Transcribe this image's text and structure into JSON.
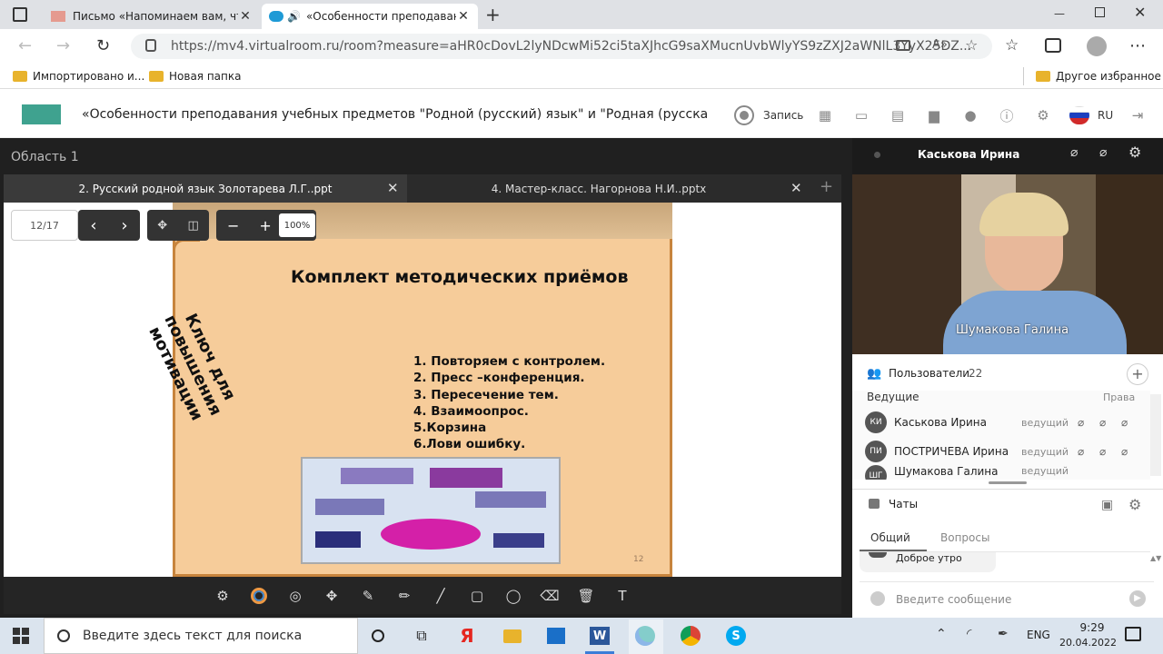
{
  "browser": {
    "tabs": [
      {
        "title": "Письмо «Напоминаем вам, что"
      },
      {
        "title": "«Особенности преподаван"
      }
    ],
    "new_tab": "+",
    "url": "https://mv4.virtualroom.ru/room?measure=aHR0cDovL2lyNDcwMi52ci5taXJhcG9saXMucnUvbWlyYS9zZXJ2aWNlL3YyX25DZ...",
    "bookmarks": [
      "Импортировано и...",
      "Новая папка"
    ],
    "other_bookmarks": "Другое избранное"
  },
  "app": {
    "title": "«Особенности преподавания учебных предметов \"Родной (русский) язык\" и \"Родная (русская) литера...",
    "record_label": "Запись",
    "lang": "RU"
  },
  "area": {
    "title": "Область 1",
    "doc_tabs": [
      "2. Русский родной язык Золотарева Л.Г..ppt",
      "4. Мастер-класс. Нагорнова Н.И..pptx"
    ],
    "page": "12/17",
    "zoom": "100%"
  },
  "slide": {
    "heading": "Комплект методических приёмов",
    "side_text": "Ключ для повышения мотивации",
    "list": [
      "1. Повторяем с контролем.",
      "2. Пресс –конференция.",
      "3. Пересечение тем.",
      "4. Взаимоопрос.",
      "5.Корзина",
      "6.Лови ошибку."
    ],
    "number": "12"
  },
  "video": {
    "host_name": "Каськова Ирина",
    "speaker_overlay": "Шумакова Галина"
  },
  "users": {
    "title": "Пользователи",
    "count": "22",
    "section": "Ведущие",
    "rights_label": "Права",
    "rows": [
      {
        "initials": "КИ",
        "name": "Каськова Ирина",
        "role": "ведущий"
      },
      {
        "initials": "ПИ",
        "name": "ПОСТРИЧЕВА Ирина",
        "role": "ведущий"
      },
      {
        "initials": "ШГ",
        "name": "Шумакова Галина",
        "role": "ведущий"
      }
    ]
  },
  "chats": {
    "title": "Чаты",
    "tabs": [
      "Общий",
      "Вопросы"
    ],
    "message": "Доброе утро",
    "input_placeholder": "Введите сообщение"
  },
  "taskbar": {
    "search_placeholder": "Введите здесь текст для поиска",
    "lang": "ENG",
    "time": "9:29",
    "date": "20.04.2022"
  },
  "colors": {
    "slide_bg": "#f6cc9a",
    "slide_border": "#c7843d",
    "accent_teal": "#3fa28f",
    "tab_active": "#ffffff"
  }
}
